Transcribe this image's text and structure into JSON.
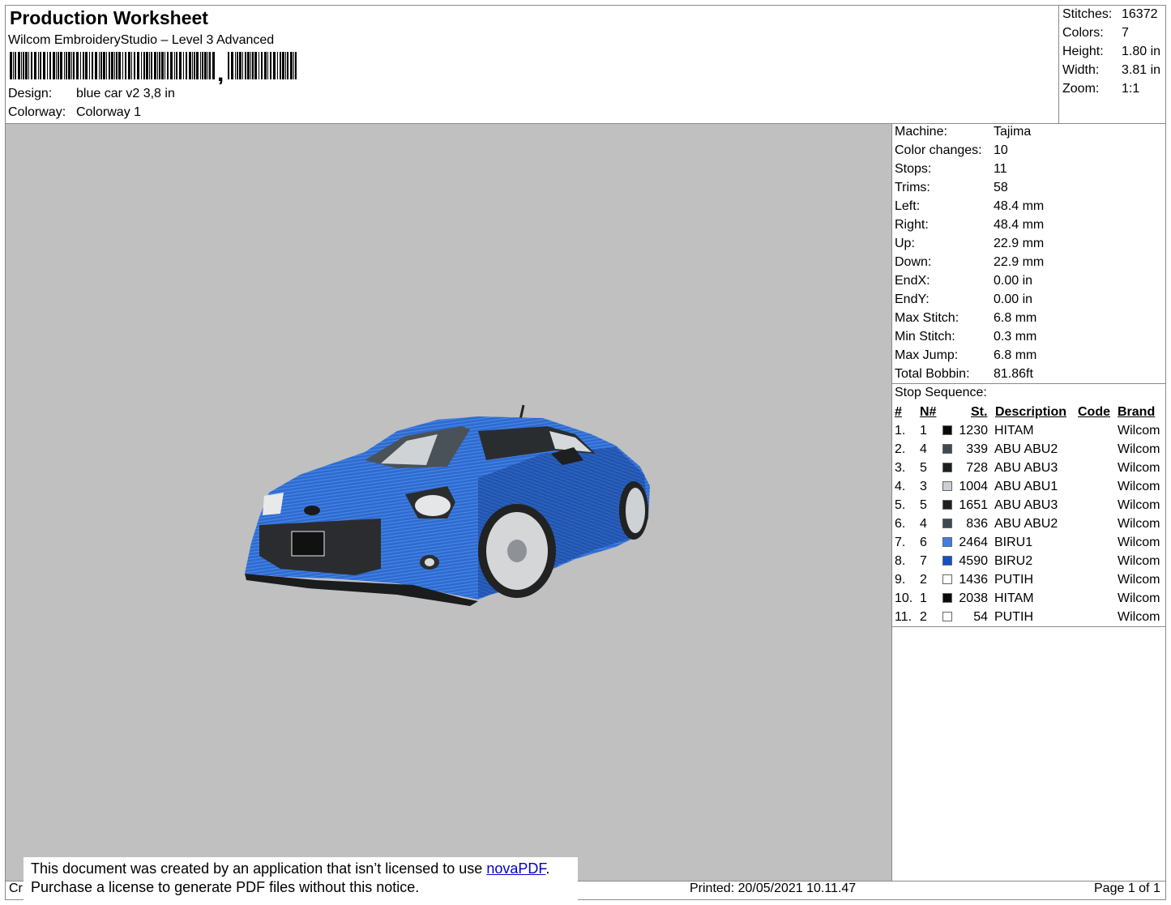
{
  "header": {
    "title": "Production Worksheet",
    "software": "Wilcom EmbroideryStudio – Level 3 Advanced",
    "design_label": "Design:",
    "design_value": "blue car v2 3,8 in",
    "colorway_label": "Colorway:",
    "colorway_value": "Colorway 1"
  },
  "summary": [
    {
      "label": "Stitches:",
      "value": "16372"
    },
    {
      "label": "Colors:",
      "value": "7"
    },
    {
      "label": "Height:",
      "value": "1.80 in"
    },
    {
      "label": "Width:",
      "value": "3.81 in"
    },
    {
      "label": "Zoom:",
      "value": "1:1"
    }
  ],
  "machine_info": [
    {
      "label": "Machine:",
      "value": "Tajima"
    },
    {
      "label": "Color changes:",
      "value": "10"
    },
    {
      "label": "Stops:",
      "value": "11"
    },
    {
      "label": "Trims:",
      "value": "58"
    },
    {
      "label": "Left:",
      "value": "48.4 mm"
    },
    {
      "label": "Right:",
      "value": "48.4 mm"
    },
    {
      "label": "Up:",
      "value": "22.9 mm"
    },
    {
      "label": "Down:",
      "value": "22.9 mm"
    },
    {
      "label": "EndX:",
      "value": "0.00 in"
    },
    {
      "label": "EndY:",
      "value": "0.00 in"
    },
    {
      "label": "Max Stitch:",
      "value": "6.8 mm"
    },
    {
      "label": "Min Stitch:",
      "value": "0.3 mm"
    },
    {
      "label": "Max Jump:",
      "value": "6.8 mm"
    },
    {
      "label": "Total Bobbin:",
      "value": "81.86ft"
    }
  ],
  "stop_sequence": {
    "title": "Stop Sequence:",
    "headers": {
      "num": "#",
      "needle": "N#",
      "stitches": "St.",
      "description": "Description",
      "code": "Code",
      "brand": "Brand"
    },
    "rows": [
      {
        "num": "1.",
        "needle": "1",
        "color": "#0a0a0a",
        "stitches": "1230",
        "description": "HITAM",
        "brand": "Wilcom"
      },
      {
        "num": "2.",
        "needle": "4",
        "color": "#3e4a52",
        "stitches": "339",
        "description": "ABU ABU2",
        "brand": "Wilcom"
      },
      {
        "num": "3.",
        "needle": "5",
        "color": "#1c1e1f",
        "stitches": "728",
        "description": "ABU ABU3",
        "brand": "Wilcom"
      },
      {
        "num": "4.",
        "needle": "3",
        "color": "#c9cfd4",
        "stitches": "1004",
        "description": "ABU ABU1",
        "brand": "Wilcom"
      },
      {
        "num": "5.",
        "needle": "5",
        "color": "#1c1e1f",
        "stitches": "1651",
        "description": "ABU ABU3",
        "brand": "Wilcom"
      },
      {
        "num": "6.",
        "needle": "4",
        "color": "#3e4a52",
        "stitches": "836",
        "description": "ABU ABU2",
        "brand": "Wilcom"
      },
      {
        "num": "7.",
        "needle": "6",
        "color": "#3f7fe0",
        "stitches": "2464",
        "description": "BIRU1",
        "brand": "Wilcom"
      },
      {
        "num": "8.",
        "needle": "7",
        "color": "#1450c8",
        "stitches": "4590",
        "description": "BIRU2",
        "brand": "Wilcom"
      },
      {
        "num": "9.",
        "needle": "2",
        "color": "#ffffff",
        "stitches": "1436",
        "description": "PUTIH",
        "brand": "Wilcom"
      },
      {
        "num": "10.",
        "needle": "1",
        "color": "#0a0a0a",
        "stitches": "2038",
        "description": "HITAM",
        "brand": "Wilcom"
      },
      {
        "num": "11.",
        "needle": "2",
        "color": "#ffffff",
        "stitches": "54",
        "description": "PUTIH",
        "brand": "Wilcom"
      }
    ]
  },
  "notice": {
    "line1_prefix": "This document was created by an application that isn’t licensed to use ",
    "link": "novaPDF",
    "line1_suffix": ".",
    "line2": "Purchase a license to generate PDF files without this notice."
  },
  "footer": {
    "left_fragment": "Cr",
    "printed": "Printed: 20/05/2021 10.11.47",
    "page": "Page 1 of 1"
  },
  "colors": {
    "canvas_bg": "#c0c0c0",
    "car_blue": "#2e6bd0"
  }
}
